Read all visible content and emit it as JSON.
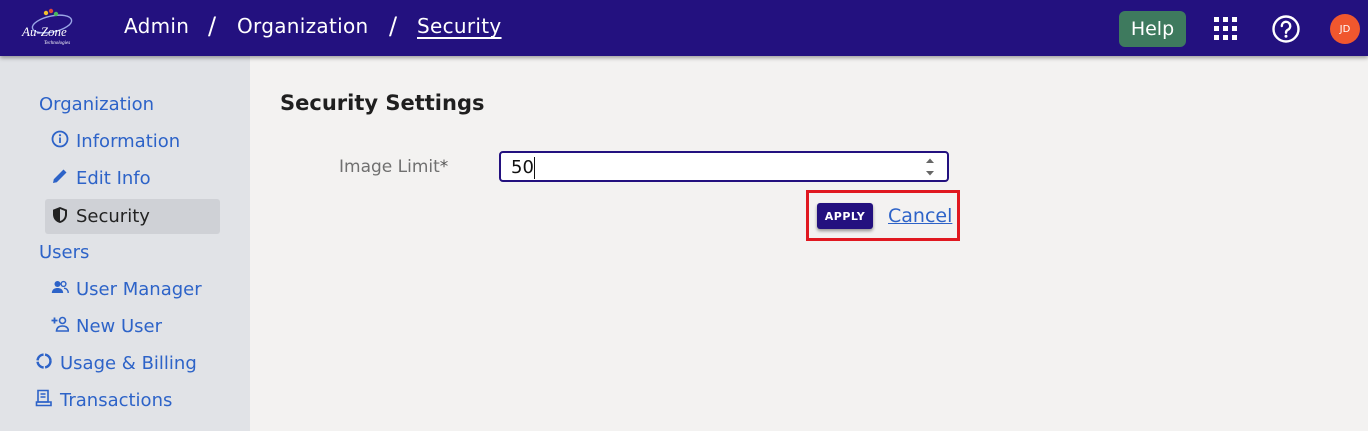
{
  "header": {
    "logo_text": "Au-Zone",
    "logo_subtext": "Technologies",
    "breadcrumb": [
      "Admin",
      "Organization",
      "Security"
    ],
    "separator": "/",
    "help_label": "Help",
    "avatar_initials": "JD"
  },
  "sidebar": {
    "sections": [
      {
        "label": "Organization",
        "items": [
          {
            "label": "Information",
            "icon": "info-icon"
          },
          {
            "label": "Edit Info",
            "icon": "pencil-icon"
          },
          {
            "label": "Security",
            "icon": "shield-icon",
            "selected": true
          }
        ]
      },
      {
        "label": "Users",
        "items": [
          {
            "label": "User Manager",
            "icon": "users-icon"
          },
          {
            "label": "New User",
            "icon": "add-user-icon"
          }
        ]
      }
    ],
    "usage_billing_label": "Usage & Billing",
    "transactions_label": "Transactions"
  },
  "main": {
    "title": "Security Settings",
    "field_label": "Image Limit",
    "field_required_mark": "*",
    "field_value": "50",
    "apply_label": "APPLY",
    "cancel_label": "Cancel"
  },
  "colors": {
    "header_bg": "#23117f",
    "help_bg": "#3e7a5e",
    "avatar_bg": "#f0572e",
    "link": "#2d63c8",
    "highlight": "#e01820"
  }
}
